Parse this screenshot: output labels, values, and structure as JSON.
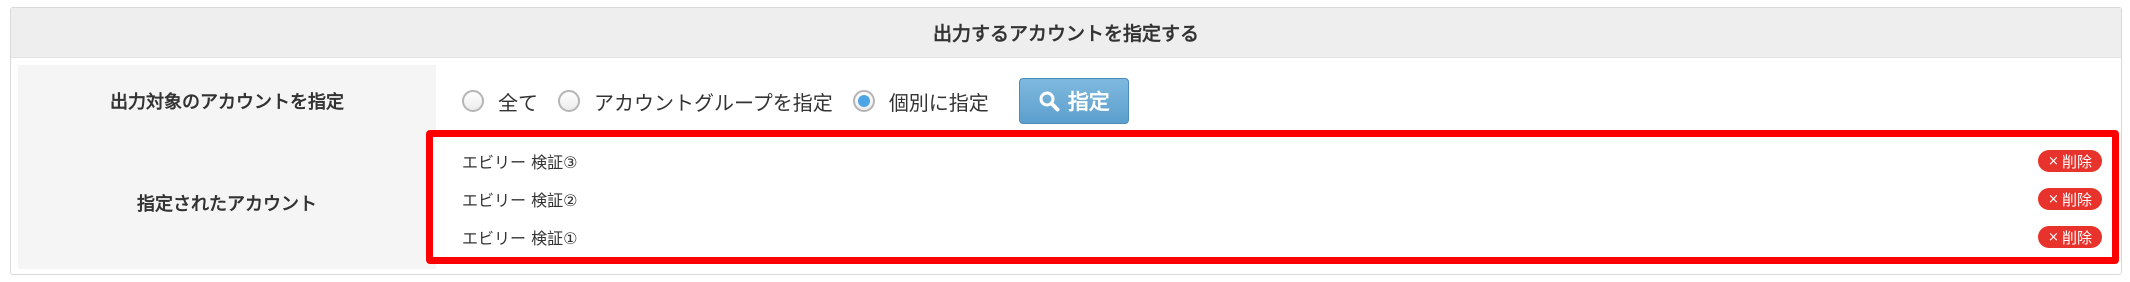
{
  "panel": {
    "title": "出力するアカウントを指定する"
  },
  "target_row": {
    "label": "出力対象のアカウントを指定",
    "options": [
      {
        "label": "全て",
        "checked": false
      },
      {
        "label": "アカウントグループを指定",
        "checked": false
      },
      {
        "label": "個別に指定",
        "checked": true
      }
    ],
    "select_button": "指定"
  },
  "selected_row": {
    "label": "指定されたアカウント",
    "accounts": [
      {
        "name": "エビリー 検証③",
        "delete_label": "削除",
        "delete_icon": "×"
      },
      {
        "name": "エビリー 検証②",
        "delete_label": "削除",
        "delete_icon": "×"
      },
      {
        "name": "エビリー 検証①",
        "delete_label": "削除",
        "delete_icon": "×"
      }
    ]
  },
  "colors": {
    "highlight_border": "#ff0000",
    "delete_badge": "#e8322c",
    "radio_checked": "#4ea5e5",
    "button_blue": "#6aa9d6"
  }
}
